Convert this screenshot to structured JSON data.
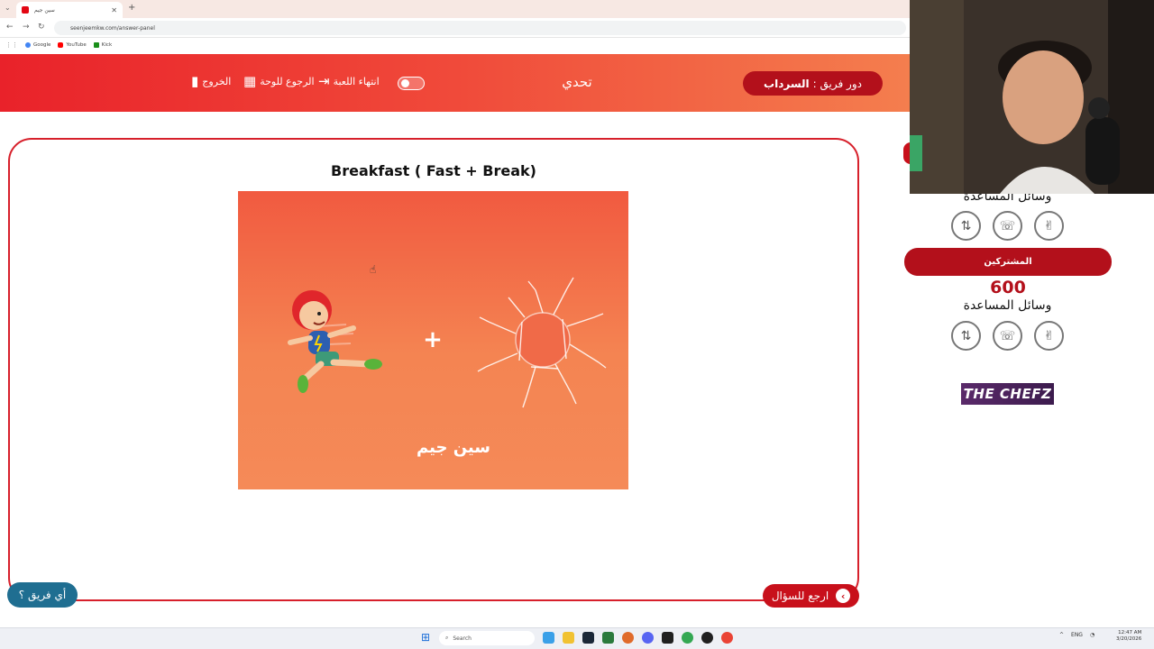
{
  "browser": {
    "tab_title": "سين جيم",
    "tab_close": "✕",
    "new_tab": "+",
    "url": "seenjeemkw.com/answer-panel",
    "bookmarks": [
      {
        "label": "Google",
        "color": "#4285f4"
      },
      {
        "label": "YouTube",
        "color": "#ff0000"
      },
      {
        "label": "Kick",
        "color": "#53fc18"
      }
    ]
  },
  "header": {
    "team_turn_prefix": "دور فريق :",
    "team_name": "السرداب",
    "title": "تحدي",
    "end_game": "انتهاء اللعبة",
    "back_to_board": "الرجوع للوحة",
    "exit": "الخروج",
    "gradient": [
      "#e9222a",
      "#f47e4e"
    ]
  },
  "question": {
    "text": "Breakfast ( Fast + Break)",
    "plus_symbol": "+",
    "logo_text": "سين جيم"
  },
  "buttons": {
    "back_to_question": "ارجع للسؤال",
    "which_team": "أي فريق ؟"
  },
  "sidebar": {
    "aids_title": "وسائل المساعدة",
    "team_label": "المشتركين",
    "team_score": "600",
    "aid_icons": [
      "call-transfer-icon",
      "phone-icon",
      "hand-peace-icon"
    ],
    "sponsor": "THE CHEFZ"
  },
  "taskbar": {
    "search_placeholder": "Search",
    "language": "ENG",
    "time": "12:47 AM",
    "date": "3/20/2026"
  },
  "colors": {
    "brand_red": "#c8101b",
    "team_blue": "#1f6e91",
    "image_orange": "#f48452"
  }
}
